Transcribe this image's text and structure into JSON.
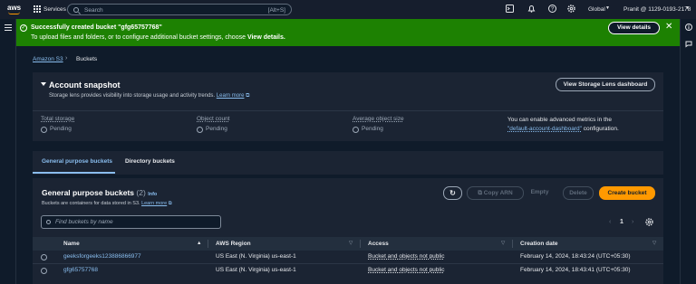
{
  "topnav": {
    "logo": "aws",
    "services": "Services",
    "search_placeholder": "Search",
    "search_shortcut": "[Alt+S]",
    "region": "Global",
    "account": "Pranit @ 1129-0193-2178"
  },
  "flash": {
    "title": "Successfully created bucket \"gfg65757768\"",
    "message_prefix": "To upload files and folders, or to configure additional bucket settings, choose ",
    "message_bold": "View details.",
    "button": "View details"
  },
  "breadcrumb": {
    "root": "Amazon S3",
    "current": "Buckets"
  },
  "snapshot": {
    "title": "Account snapshot",
    "subtitle": "Storage lens provides visibility into storage usage and activity trends.",
    "learn_more": "Learn more",
    "lens_button": "View Storage Lens dashboard",
    "metrics": [
      {
        "label": "Total storage",
        "value": "Pending"
      },
      {
        "label": "Object count",
        "value": "Pending"
      },
      {
        "label": "Average object size",
        "value": "Pending"
      }
    ],
    "advanced_prefix": "You can enable advanced metrics in the",
    "advanced_link": "\"default-account-dashboard\"",
    "advanced_suffix": " configuration."
  },
  "tabs": [
    {
      "label": "General purpose buckets",
      "active": true
    },
    {
      "label": "Directory buckets",
      "active": false
    }
  ],
  "buckets": {
    "title": "General purpose buckets",
    "count": "(2)",
    "info": "Info",
    "subtitle": "Buckets are containers for data stored in S3.",
    "learn_more": "Learn more",
    "copy_arn": "Copy ARN",
    "empty": "Empty",
    "delete": "Delete",
    "create": "Create bucket",
    "find_placeholder": "Find buckets by name",
    "page": "1",
    "columns": [
      "Name",
      "AWS Region",
      "Access",
      "Creation date"
    ],
    "rows": [
      {
        "name": "geeksforgeeks123886866977",
        "region": "US East (N. Virginia) us-east-1",
        "access": "Bucket and objects not public",
        "created": "February 14, 2024, 18:43:24 (UTC+05:30)"
      },
      {
        "name": "gfg65757768",
        "region": "US East (N. Virginia) us-east-1",
        "access": "Bucket and objects not public",
        "created": "February 14, 2024, 18:43:41 (UTC+05:30)"
      }
    ]
  },
  "colors": {
    "success": "#1d8102",
    "primary": "#ff9900",
    "link": "#89bdee"
  }
}
